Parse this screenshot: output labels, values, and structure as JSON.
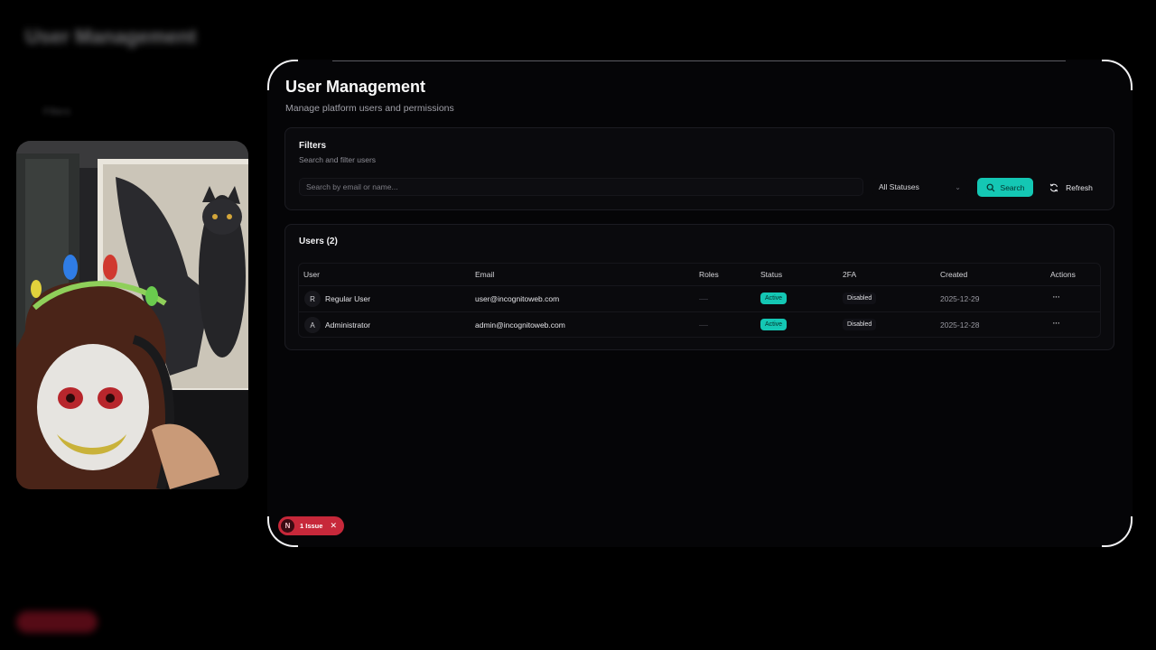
{
  "background": {
    "title": "User Management",
    "subtitle": "Filters"
  },
  "page": {
    "title": "User Management",
    "subtitle": "Manage platform users and permissions"
  },
  "filters": {
    "title": "Filters",
    "subtitle": "Search and filter users",
    "search_placeholder": "Search by email or name...",
    "status_value": "All Statuses",
    "search_button": "Search",
    "refresh_button": "Refresh"
  },
  "users": {
    "title": "Users (2)",
    "columns": [
      "User",
      "Email",
      "Roles",
      "Status",
      "2FA",
      "Created",
      "Actions"
    ],
    "rows": [
      {
        "initial": "R",
        "name": "Regular User",
        "email": "user@incognitoweb.com",
        "status": "Active",
        "twofa": "Disabled",
        "created": "2025-12-29",
        "actions": "···"
      },
      {
        "initial": "A",
        "name": "Administrator",
        "email": "admin@incognitoweb.com",
        "status": "Active",
        "twofa": "Disabled",
        "created": "2025-12-28",
        "actions": "···"
      }
    ]
  },
  "issue": {
    "initial": "N",
    "label": "1 Issue",
    "close": "✕"
  },
  "colors": {
    "accent": "#14c7b4",
    "issue": "#c7283a",
    "background": "#000000"
  },
  "icons": {
    "search": "magnifier-icon",
    "refresh": "refresh-icon",
    "chevron": "chevron-down-icon"
  }
}
